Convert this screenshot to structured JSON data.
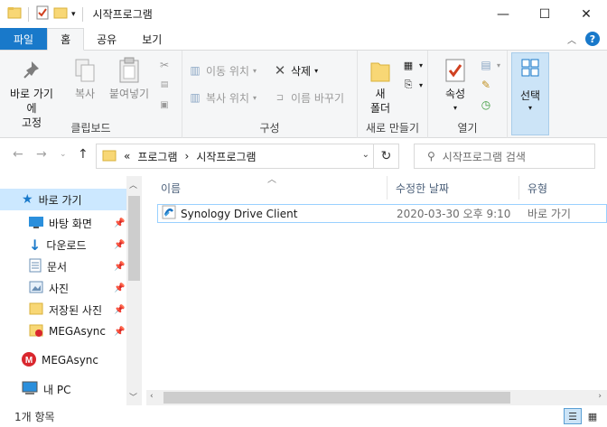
{
  "window": {
    "title": "시작프로그램",
    "controls": {
      "minimize": "—",
      "maximize": "☐",
      "close": "✕"
    }
  },
  "ribbon_tabs": [
    "파일",
    "홈",
    "공유",
    "보기"
  ],
  "ribbon": {
    "clipboard": {
      "pin": "바로 가기에 고정",
      "pin_line1": "바로 가기에",
      "pin_line2": "고정",
      "copy": "복사",
      "paste": "붙여넣기",
      "group": "클립보드"
    },
    "organize": {
      "move_to": "이동 위치",
      "copy_to": "복사 위치",
      "delete": "삭제",
      "rename": "이름 바꾸기",
      "group": "구성"
    },
    "new": {
      "folder_line1": "새",
      "folder_line2": "폴더",
      "group": "새로 만들기"
    },
    "open": {
      "properties": "속성",
      "group": "열기"
    },
    "select": {
      "label": "선택"
    }
  },
  "address": {
    "chevrons": "«",
    "crumbs": [
      "프로그램",
      "시작프로그램"
    ],
    "separator": "›"
  },
  "search": {
    "placeholder": "시작프로그램 검색"
  },
  "nav_pane": {
    "items": [
      {
        "label": "바로 가기",
        "icon": "star-icon",
        "pinned": false,
        "selected": true
      },
      {
        "label": "바탕 화면",
        "icon": "desktop-icon",
        "pinned": true
      },
      {
        "label": "다운로드",
        "icon": "download-icon",
        "pinned": true
      },
      {
        "label": "문서",
        "icon": "document-icon",
        "pinned": true
      },
      {
        "label": "사진",
        "icon": "pictures-icon",
        "pinned": true
      },
      {
        "label": "저장된 사진",
        "icon": "folder-icon",
        "pinned": true
      },
      {
        "label": "MEGAsync",
        "icon": "mega-folder-icon",
        "pinned": true
      },
      {
        "label": "MEGAsync",
        "icon": "mega-icon",
        "pinned": false
      },
      {
        "label": "내 PC",
        "icon": "pc-icon",
        "pinned": false
      }
    ]
  },
  "columns": [
    "이름",
    "수정한 날짜",
    "유형"
  ],
  "files": [
    {
      "name": "Synology Drive Client",
      "modified": "2020-03-30 오후 9:10",
      "type": "바로 가기",
      "icon": "synology-shortcut-icon"
    }
  ],
  "status": {
    "count": "1개 항목"
  },
  "colors": {
    "accent": "#1979ca",
    "selection": "#cce8ff",
    "folder": "#f8d775"
  }
}
